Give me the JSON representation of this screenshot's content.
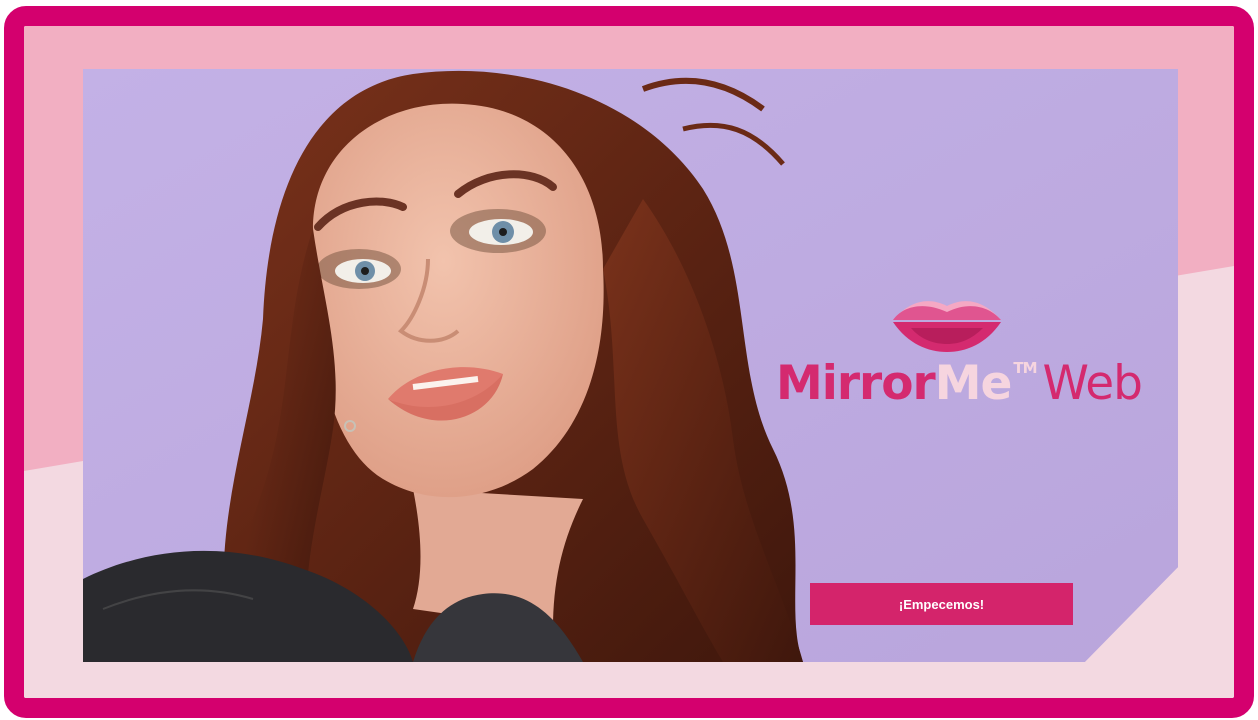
{
  "brand": {
    "name_part1": "Mirror",
    "name_part2": "Me",
    "trademark": "TM",
    "name_part3": "Web",
    "logo_icon": "lips-icon"
  },
  "cta": {
    "label": "¡Empecemos!"
  },
  "hero": {
    "image": "model-portrait"
  },
  "colors": {
    "frame": "#d4006e",
    "outer_pink": "#f2afc2",
    "inner_pink": "#f3d9e1",
    "hero_background": "#c6b3e8",
    "brand_magenta": "#d42a6f",
    "brand_light": "#f6d5df",
    "button": "#d4246b"
  }
}
